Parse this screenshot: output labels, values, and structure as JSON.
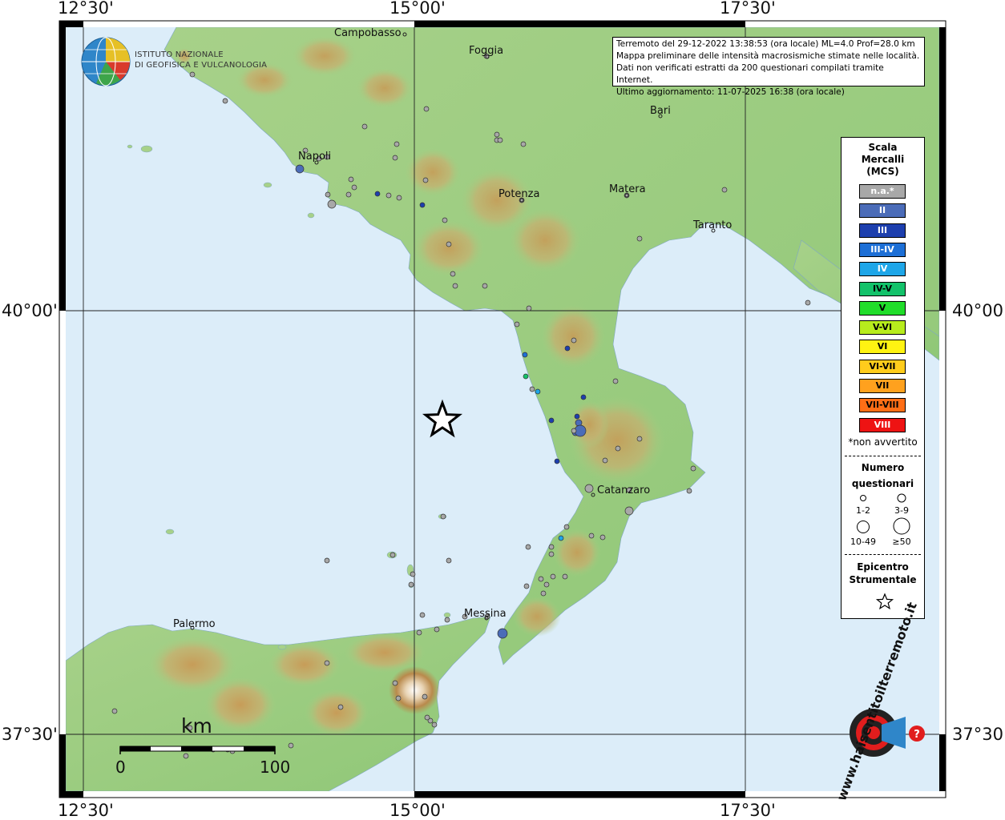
{
  "map": {
    "coord_labels": {
      "top": [
        "12°30'",
        "15°00'",
        "17°30'"
      ],
      "bottom": [
        "12°30'",
        "15°00'",
        "17°30'"
      ],
      "left": [
        "40°00'",
        "37°30'"
      ],
      "right": [
        "40°00'",
        "37°30'"
      ]
    },
    "places": [
      "Campobasso",
      "Foggia",
      "Bari",
      "Napoli",
      "Potenza",
      "Matera",
      "Taranto",
      "Catanzaro",
      "Palermo",
      "Messina"
    ],
    "colors": {
      "sea": "#d9ecf8",
      "land_low": "#9ccf7f",
      "land_high": "#c7a76a",
      "frame": "#000000"
    }
  },
  "logo": {
    "org_line1": "ISTITUTO NAZIONALE",
    "org_line2": "DI GEOFISICA E VULCANOLOGIA"
  },
  "info": {
    "lines": [
      "Terremoto del 29-12-2022 13:38:53 (ora locale) ML=4.0 Prof=28.0 km",
      "Mappa preliminare delle intensità macrosismiche stimate nelle località.",
      "Dati non verificati estratti da 200 questionari compilati tramite Internet.",
      "Ultimo aggiornamento: 11-07-2025 16:38 (ora locale)"
    ]
  },
  "legend": {
    "title": [
      "Scala",
      "Mercalli",
      "(MCS)"
    ],
    "classes": [
      {
        "label": "n.a.*",
        "color": "#a8a8a8",
        "text_color": "#ffffff"
      },
      {
        "label": "II",
        "color": "#4b6cb8",
        "text_color": "#ffffff"
      },
      {
        "label": "III",
        "color": "#1d3fae",
        "text_color": "#ffffff"
      },
      {
        "label": "III-IV",
        "color": "#1d6fd6",
        "text_color": "#ffffff"
      },
      {
        "label": "IV",
        "color": "#1ea6e8",
        "text_color": "#ffffff"
      },
      {
        "label": "IV-V",
        "color": "#13c26a",
        "text_color": "#000000"
      },
      {
        "label": "V",
        "color": "#21dd2a",
        "text_color": "#000000"
      },
      {
        "label": "V-VI",
        "color": "#b7ec1d",
        "text_color": "#000000"
      },
      {
        "label": "VI",
        "color": "#fff312",
        "text_color": "#000000"
      },
      {
        "label": "VI-VII",
        "color": "#ffcc1c",
        "text_color": "#000000"
      },
      {
        "label": "VII",
        "color": "#ffa11e",
        "text_color": "#000000"
      },
      {
        "label": "VII-VIII",
        "color": "#ff6e16",
        "text_color": "#000000"
      },
      {
        "label": "VIII",
        "color": "#ee1313",
        "text_color": "#ffffff"
      }
    ],
    "not_felt_note": "*non avvertito",
    "questionnaires_title": [
      "Numero",
      "questionari"
    ],
    "size_classes": [
      "1-2",
      "3-9",
      "10-49",
      "≥50"
    ],
    "epicenter_title": [
      "Epicentro",
      "Strumentale"
    ]
  },
  "scale_bar": {
    "unit": "km",
    "min_label": "0",
    "max_label": "100"
  },
  "watermark": {
    "text": "www.haisentitoilterremoto.it"
  }
}
